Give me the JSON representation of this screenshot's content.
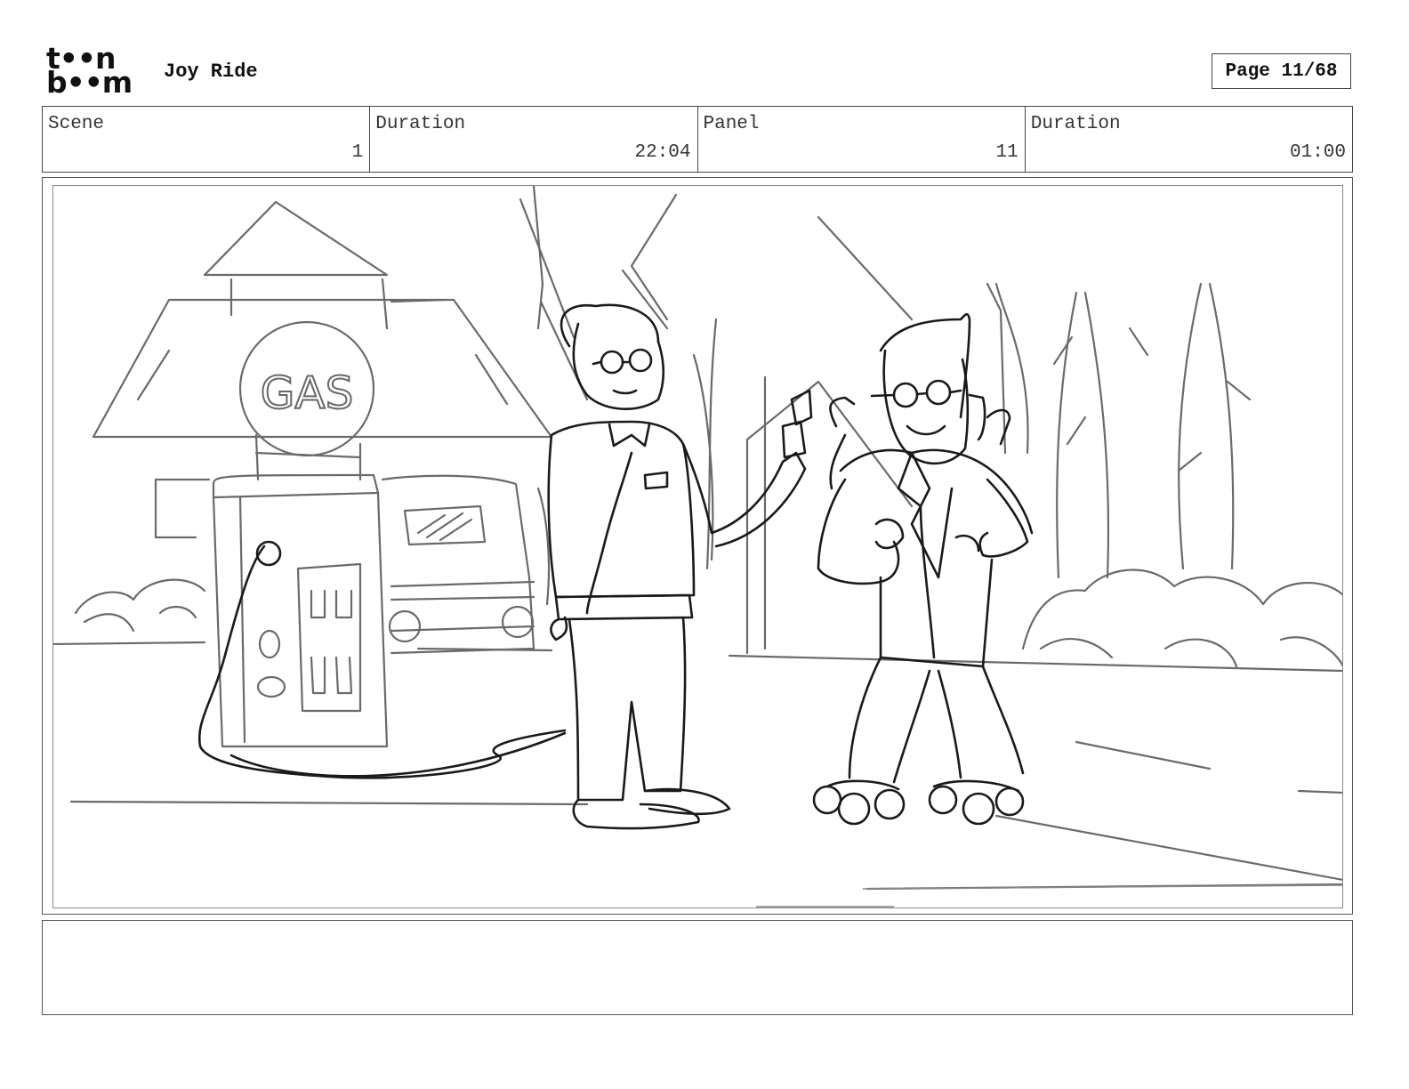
{
  "header": {
    "logo_top": "t••n",
    "logo_bottom": "b••m",
    "project_title": "Joy Ride",
    "page_label": "Page 11/68"
  },
  "info": {
    "scene_label": "Scene",
    "scene_value": "1",
    "scene_duration_label": "Duration",
    "scene_duration_value": "22:04",
    "panel_label": "Panel",
    "panel_value": "11",
    "panel_duration_label": "Duration",
    "panel_duration_value": "01:00"
  },
  "sketch": {
    "sign_text": "GAS"
  },
  "notes": {
    "text": ""
  }
}
